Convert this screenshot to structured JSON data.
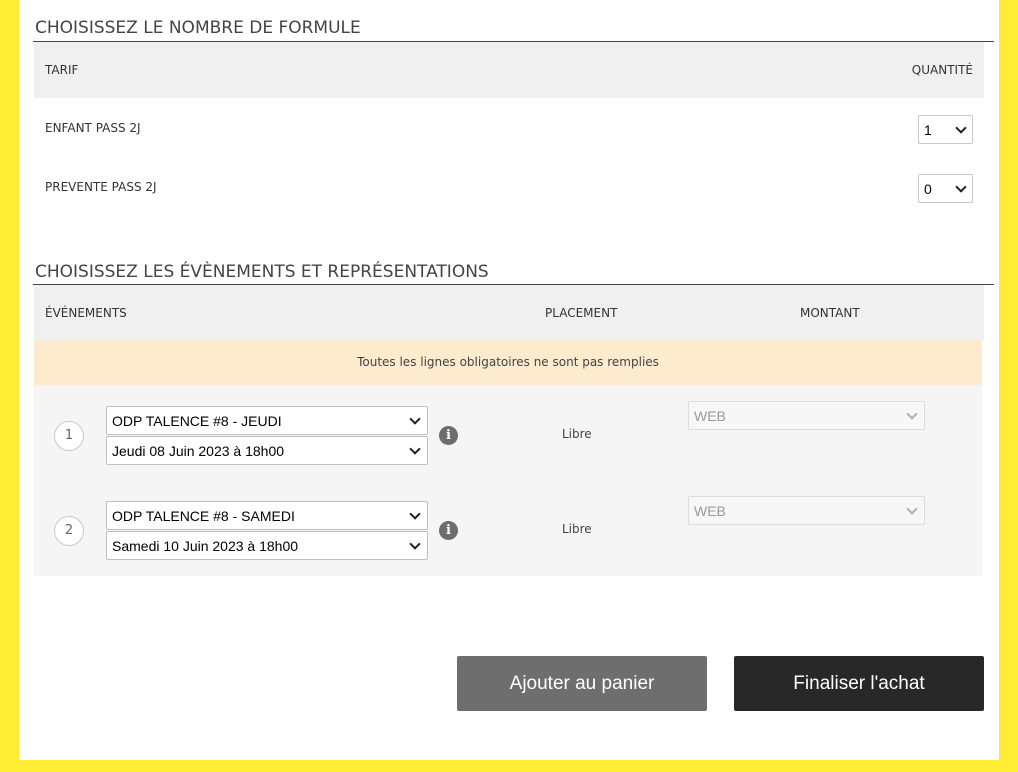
{
  "formules": {
    "title": "Choisissez le nombre de formule",
    "header": {
      "tarif": "TARIF",
      "quantite": "QUANTITÉ"
    },
    "rows": [
      {
        "label": "ENFANT PASS 2J",
        "quantity": "1"
      },
      {
        "label": "PREVENTE PASS 2J",
        "quantity": "0"
      }
    ]
  },
  "evenements": {
    "title": "Choisissez les évènements et représentations",
    "header": {
      "evenements": "ÉVÉNEMENTS",
      "placement": "PLACEMENT",
      "montant": "MONTANT"
    },
    "alert": "Toutes les lignes obligatoires ne sont pas remplies",
    "rows": [
      {
        "number": "1",
        "event": "ODP TALENCE #8 - JEUDI",
        "date": "Jeudi 08 Juin 2023 à 18h00",
        "info_icon": "info-icon",
        "placement": "Libre",
        "montant": "WEB"
      },
      {
        "number": "2",
        "event": "ODP TALENCE #8 - SAMEDI",
        "date": "Samedi 10 Juin 2023 à 18h00",
        "info_icon": "info-icon",
        "placement": "Libre",
        "montant": "WEB"
      }
    ]
  },
  "actions": {
    "add_to_cart": "Ajouter au panier",
    "checkout": "Finaliser l'achat"
  },
  "colors": {
    "frame": "#ffed35",
    "alert_bg": "#fdebce",
    "add_button": "#6e6e6e",
    "checkout_button": "#282828"
  }
}
